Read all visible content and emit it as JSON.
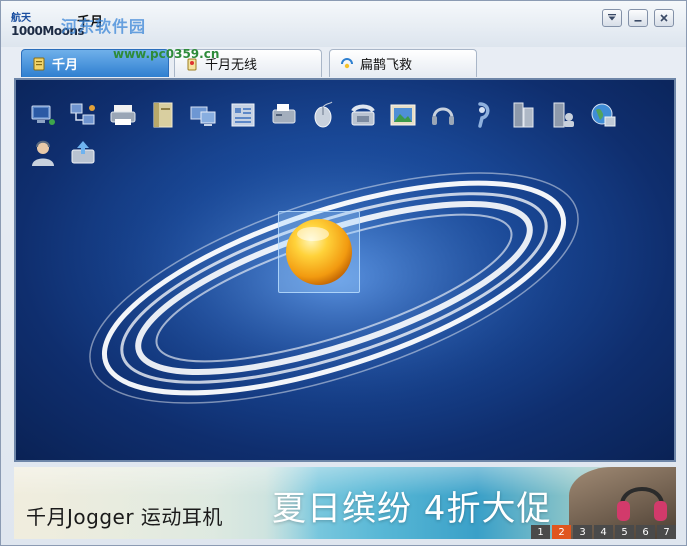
{
  "window": {
    "brand_top": "航天",
    "brand_bottom": "1000Moons",
    "title": "千月",
    "watermark": "河东软件园",
    "watermark_url": "www.pc0359.cn",
    "controls": {
      "dropdown": "chevron-down-icon",
      "minimize": "minimize-icon",
      "close": "close-icon"
    }
  },
  "tabs": [
    {
      "label": "千月",
      "icon": "qianyue-tab-icon",
      "active": true
    },
    {
      "label": "千月无线",
      "icon": "wireless-tab-icon",
      "active": false
    },
    {
      "label": "扁鹊飞救",
      "icon": "rescue-tab-icon",
      "active": false
    }
  ],
  "toolbar_icons": [
    "network-computer-icon",
    "network-connection-icon",
    "printer-icon",
    "book-icon",
    "monitor-network-icon",
    "directory-icon",
    "fax-printer-icon",
    "mouse-icon",
    "telephone-icon",
    "picture-icon",
    "headset-icon",
    "earpiece-icon",
    "panel-icon",
    "panel-user-icon",
    "globe-icon",
    "user-icon",
    "upload-icon"
  ],
  "banner": {
    "text_left": "千月Jogger 运动耳机",
    "text_big": "夏日缤纷 4折大促",
    "pages": [
      "1",
      "2",
      "3",
      "4",
      "5",
      "6",
      "7"
    ],
    "active_page": "2"
  },
  "colors": {
    "active_tab": "#3a86d6",
    "panel_bg": "#1a4a9a",
    "pager_active": "#e0561f"
  }
}
